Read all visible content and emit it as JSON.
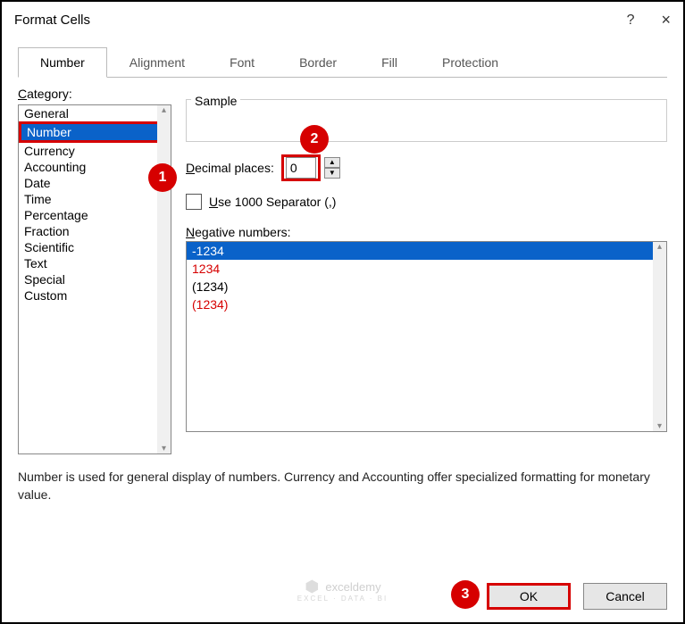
{
  "title": "Format Cells",
  "titlebar": {
    "help": "?",
    "close": "×"
  },
  "tabs": [
    "Number",
    "Alignment",
    "Font",
    "Border",
    "Fill",
    "Protection"
  ],
  "active_tab": 0,
  "category_label": "Category:",
  "categories": [
    "General",
    "Number",
    "Currency",
    "Accounting",
    "Date",
    "Time",
    "Percentage",
    "Fraction",
    "Scientific",
    "Text",
    "Special",
    "Custom"
  ],
  "selected_category": 1,
  "sample": {
    "legend": "Sample",
    "value": ""
  },
  "decimal": {
    "label_u": "D",
    "label_rest": "ecimal places:",
    "value": "0"
  },
  "separator": {
    "label_u": "U",
    "label_rest": "se 1000 Separator (,)",
    "checked": false
  },
  "negative": {
    "label_u": "N",
    "label_rest": "egative numbers:"
  },
  "neg_items": [
    {
      "text": "-1234",
      "sel": true,
      "red": false
    },
    {
      "text": "1234",
      "sel": false,
      "red": true
    },
    {
      "text": "(1234)",
      "sel": false,
      "red": false
    },
    {
      "text": "(1234)",
      "sel": false,
      "red": true
    }
  ],
  "description": "Number is used for general display of numbers.  Currency and Accounting offer specialized formatting for monetary value.",
  "buttons": {
    "ok": "OK",
    "cancel": "Cancel"
  },
  "badges": {
    "one": "1",
    "two": "2",
    "three": "3"
  },
  "watermark": {
    "name": "exceldemy",
    "sub": "EXCEL · DATA · BI"
  }
}
